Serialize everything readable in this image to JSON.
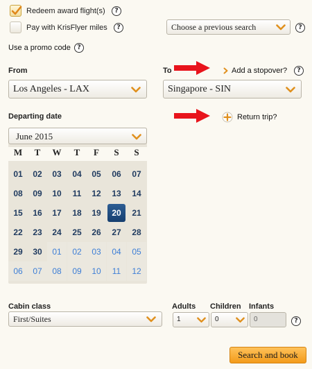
{
  "options": {
    "redeem_award_label": "Redeem award flight(s)",
    "redeem_award_checked": true,
    "pay_krisflyer_label": "Pay with KrisFlyer miles",
    "pay_krisflyer_checked": false,
    "previous_search_value": "Choose a previous search",
    "promo_code_label": "Use a promo code"
  },
  "route": {
    "from_label": "From",
    "from_value": "Los Angeles - LAX",
    "to_label": "To",
    "to_value": "Singapore - SIN",
    "stopover_label": "Add a stopover?"
  },
  "dates": {
    "departing_label": "Departing date",
    "return_trip_label": "Return trip?"
  },
  "calendar": {
    "month_value": "June 2015",
    "weekdays": [
      "M",
      "T",
      "W",
      "T",
      "F",
      "S",
      "S"
    ],
    "weeks": [
      [
        "01",
        "02",
        "03",
        "04",
        "05",
        "06",
        "07"
      ],
      [
        "08",
        "09",
        "10",
        "11",
        "12",
        "13",
        "14"
      ],
      [
        "15",
        "16",
        "17",
        "18",
        "19",
        "20",
        "21"
      ],
      [
        "22",
        "23",
        "24",
        "25",
        "26",
        "27",
        "28"
      ],
      [
        "29",
        "30",
        "01",
        "02",
        "03",
        "04",
        "05"
      ],
      [
        "06",
        "07",
        "08",
        "09",
        "10",
        "11",
        "12"
      ]
    ],
    "selected_day": "20",
    "next_month_start_index": 30
  },
  "cabin": {
    "cabin_label": "Cabin class",
    "cabin_value": "First/Suites",
    "adults_label": "Adults",
    "adults_value": "1",
    "children_label": "Children",
    "children_value": "0",
    "infants_label": "Infants",
    "infants_value": "0"
  },
  "actions": {
    "search_label": "Search and book"
  },
  "colors": {
    "accent_orange": "#f39b1a",
    "selected_day_bg": "#1f4f86",
    "next_month_day": "#3d7ed6",
    "arrow_red": "#e8141c"
  }
}
